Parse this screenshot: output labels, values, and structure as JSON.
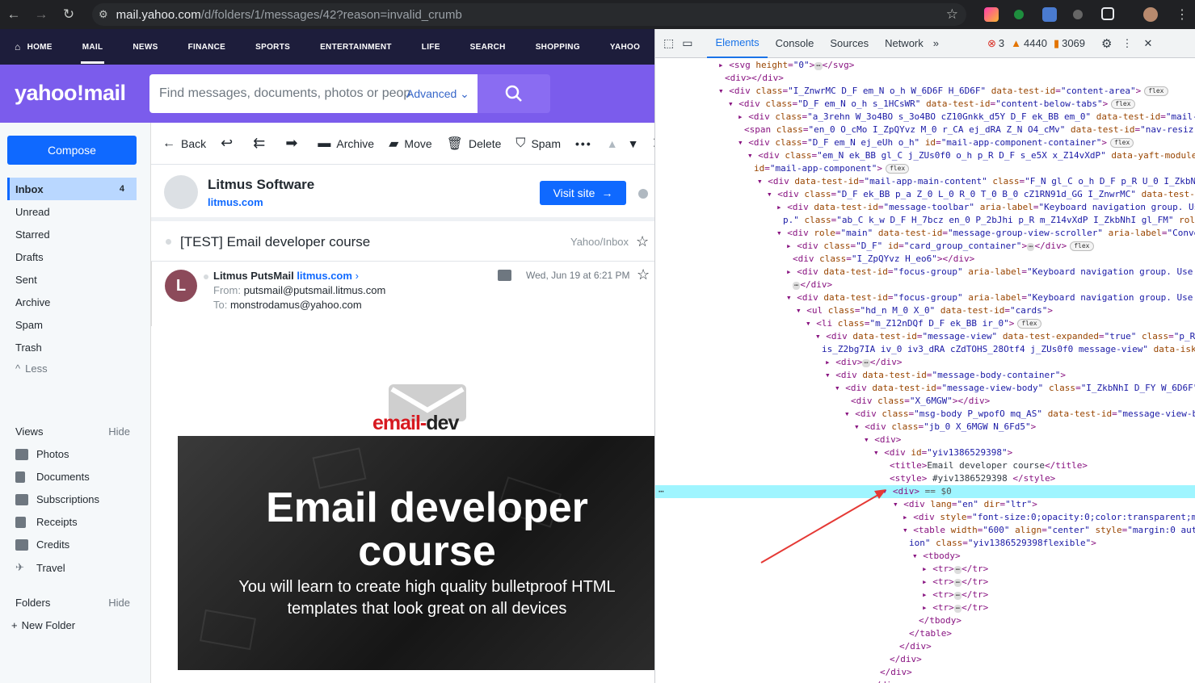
{
  "browser": {
    "url_host": "mail.yahoo.com",
    "url_path": "/d/folders/1/messages/42?reason=invalid_crumb"
  },
  "topnav": [
    "HOME",
    "MAIL",
    "NEWS",
    "FINANCE",
    "SPORTS",
    "ENTERTAINMENT",
    "LIFE",
    "SEARCH",
    "SHOPPING",
    "YAHOO"
  ],
  "logo": "yahoo!mail",
  "search": {
    "placeholder": "Find messages, documents, photos or peop",
    "advanced": "Advanced"
  },
  "compose": "Compose",
  "folders": [
    {
      "label": "Inbox",
      "count": "4"
    },
    {
      "label": "Unread"
    },
    {
      "label": "Starred"
    },
    {
      "label": "Drafts"
    },
    {
      "label": "Sent"
    },
    {
      "label": "Archive"
    },
    {
      "label": "Spam"
    },
    {
      "label": "Trash"
    },
    {
      "label": "Less"
    }
  ],
  "views": {
    "title": "Views",
    "hide": "Hide",
    "items": [
      "Photos",
      "Documents",
      "Subscriptions",
      "Receipts",
      "Credits",
      "Travel"
    ]
  },
  "foldersect": {
    "title": "Folders",
    "hide": "Hide",
    "new": "New Folder"
  },
  "toolbar": {
    "back": "Back",
    "archive": "Archive",
    "move": "Move",
    "delete": "Delete",
    "spam": "Spam"
  },
  "sender": {
    "name": "Litmus Software",
    "domain": "litmus.com",
    "visit": "Visit site"
  },
  "subject": {
    "text": "[TEST] Email developer course",
    "folder": "Yahoo/Inbox"
  },
  "message": {
    "from_name": "Litmus PutsMail",
    "from_domain": "litmus.com",
    "from_label": "From:",
    "from_addr": "putsmail@putsmail.litmus.com",
    "to_label": "To:",
    "to_addr": "monstrodamus@yahoo.com",
    "date": "Wed, Jun 19 at 6:21 PM"
  },
  "email_logo": {
    "left": "email-",
    "right": "dev"
  },
  "banner": {
    "title1": "Email developer",
    "title2": "course",
    "sub1": "You will learn to create high quality bulletproof HTML",
    "sub2": "templates that look great on all devices"
  },
  "devtools": {
    "tabs": [
      "Elements",
      "Console",
      "Sources",
      "Network"
    ],
    "errors": "3",
    "warnings": "4440",
    "issues": "3069"
  },
  "colors": {
    "yahoo_purple": "#7b5cec",
    "compose_blue": "#0f69ff",
    "selection": "#9ff5ff",
    "arrow": "#e53935"
  }
}
